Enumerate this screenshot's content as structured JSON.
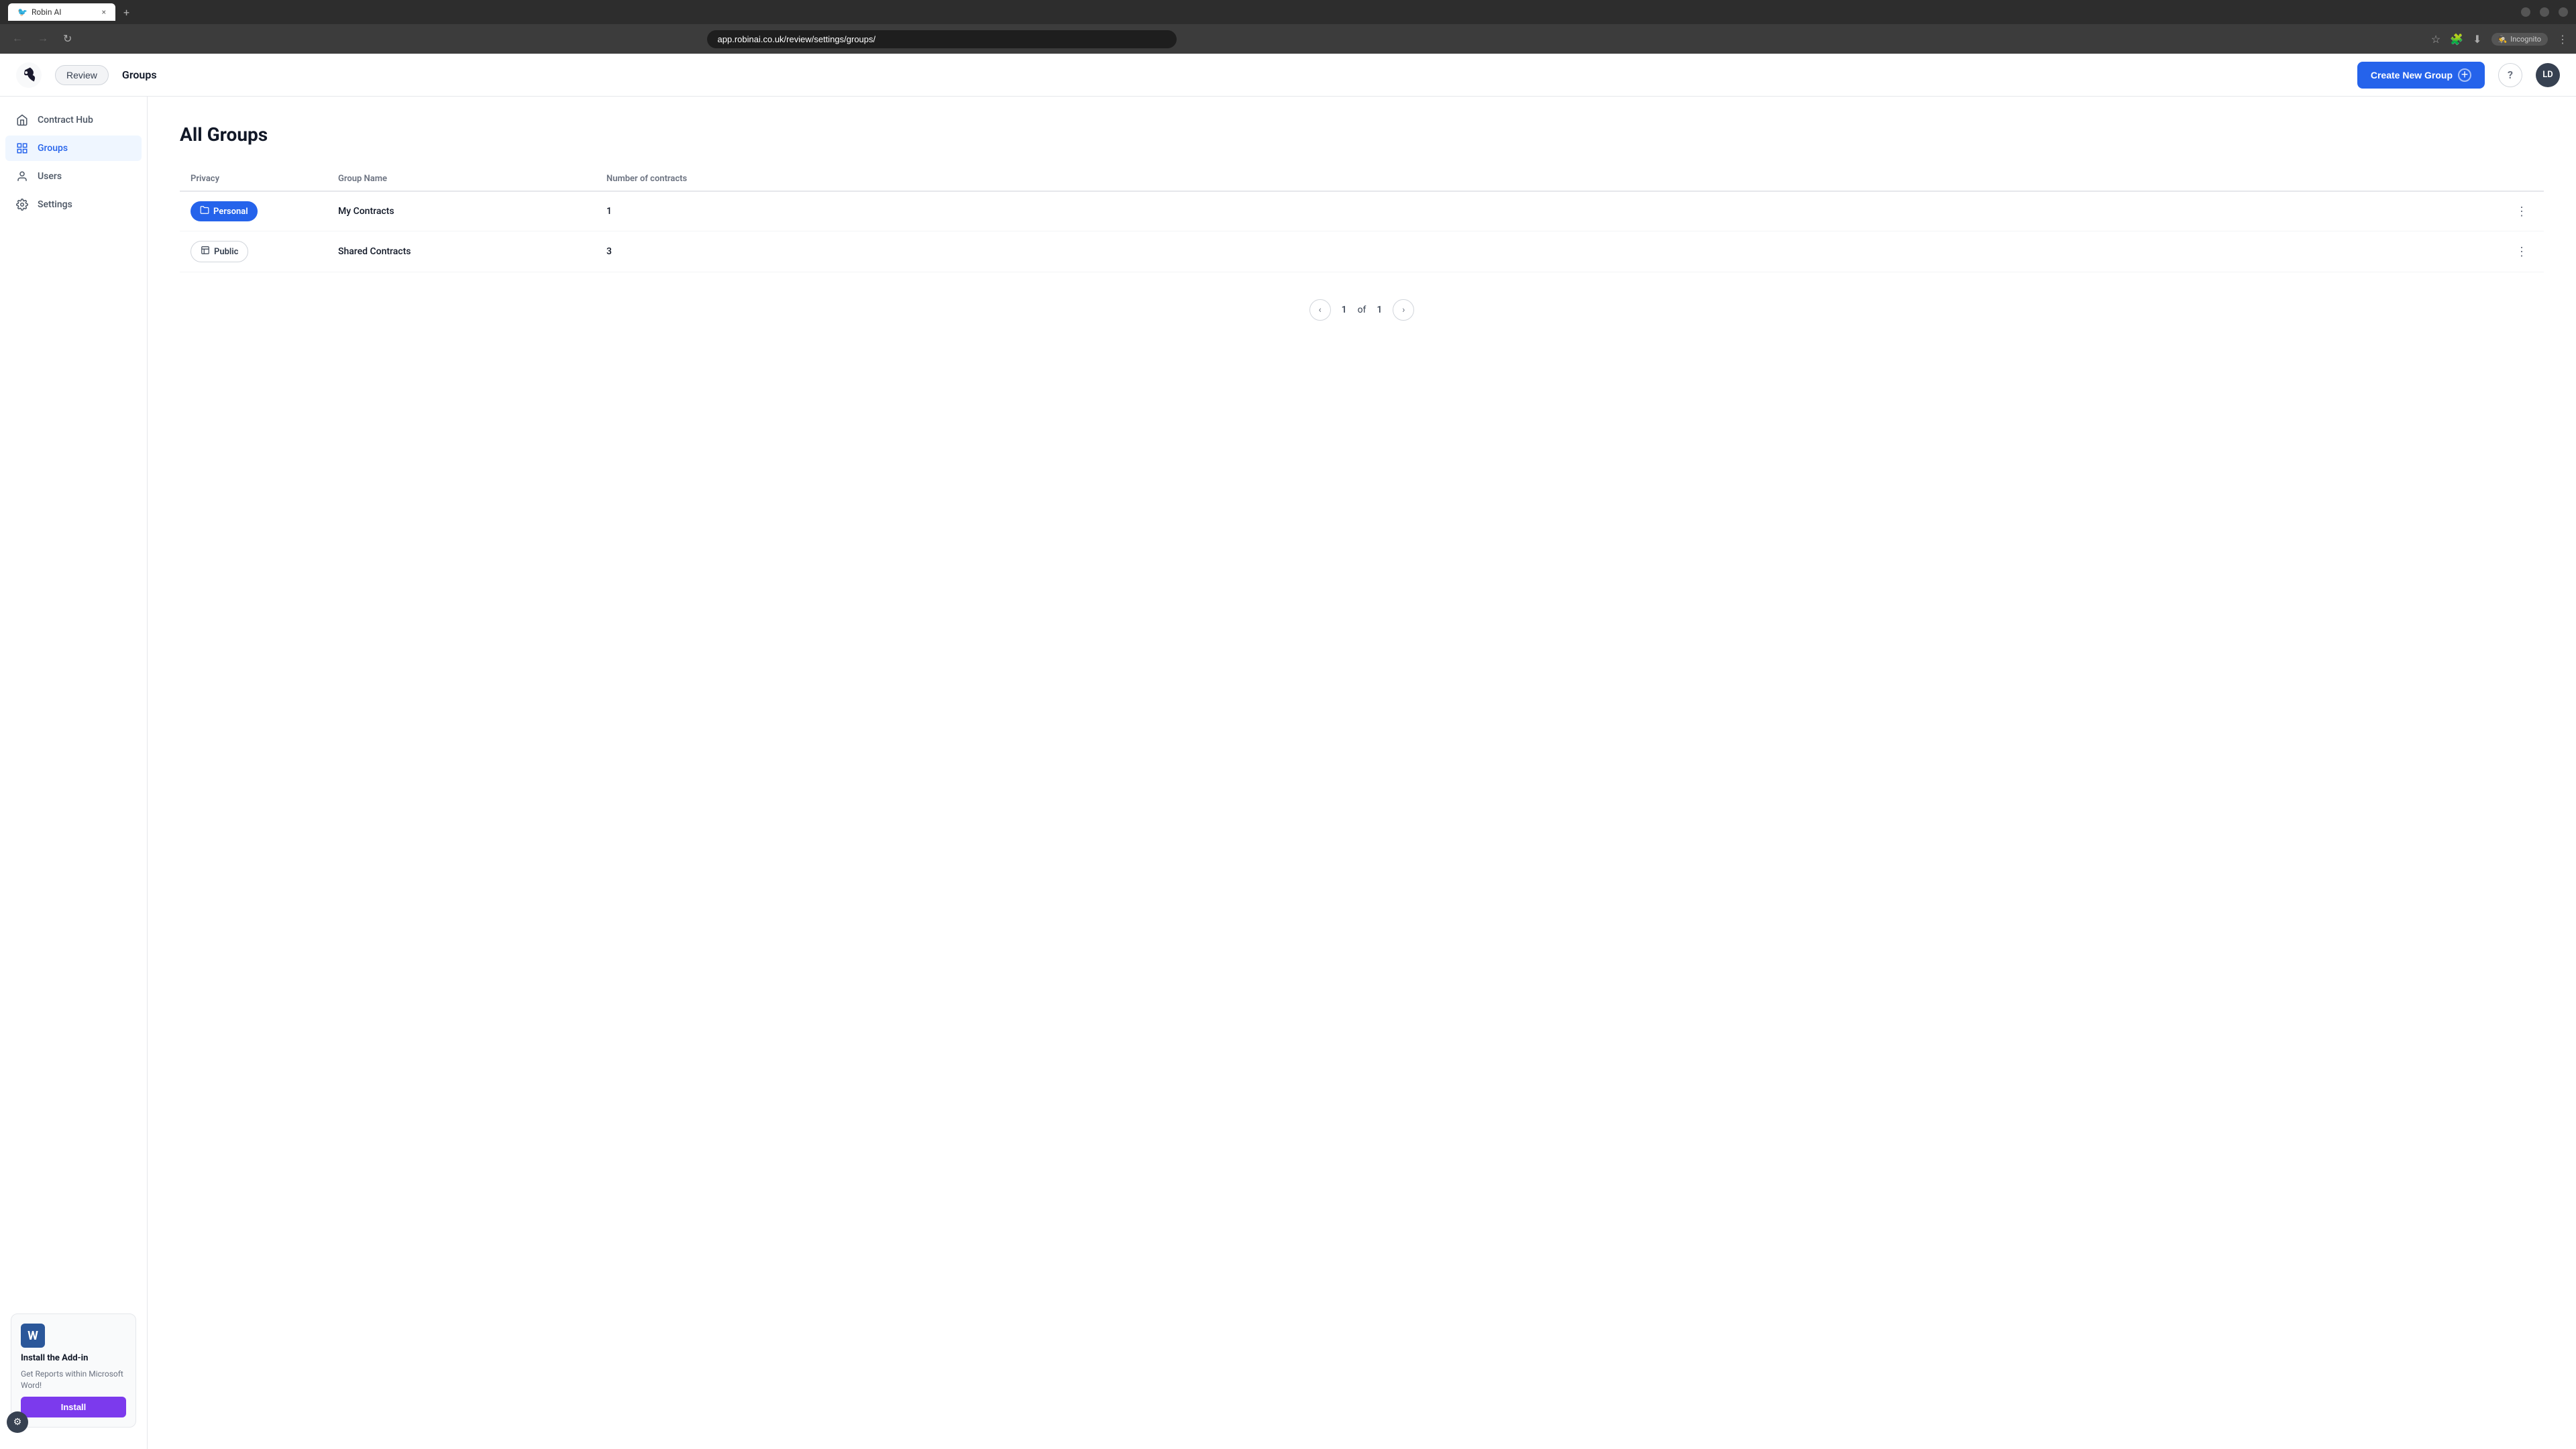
{
  "browser": {
    "tab_favicon": "🐦",
    "tab_title": "Robin AI",
    "tab_close": "×",
    "new_tab": "+",
    "url": "app.robinai.co.uk/review/settings/groups/",
    "incognito_label": "Incognito"
  },
  "header": {
    "review_label": "Review",
    "page_title": "Groups",
    "create_button_label": "Create New Group",
    "help_label": "?",
    "avatar_label": "LD"
  },
  "sidebar": {
    "items": [
      {
        "id": "contract-hub",
        "label": "Contract Hub",
        "icon": "🏠",
        "active": false
      },
      {
        "id": "groups",
        "label": "Groups",
        "icon": "⊞",
        "active": true
      },
      {
        "id": "users",
        "label": "Users",
        "icon": "👤",
        "active": false
      },
      {
        "id": "settings",
        "label": "Settings",
        "icon": "⚙",
        "active": false
      }
    ],
    "addon": {
      "word_icon": "W",
      "title": "Install the Add-in",
      "description": "Get Reports within Microsoft Word!",
      "install_button": "Install"
    }
  },
  "main": {
    "page_title": "All Groups",
    "table": {
      "headers": [
        "Privacy",
        "Group Name",
        "Number of contracts"
      ],
      "rows": [
        {
          "privacy_type": "personal",
          "privacy_label": "Personal",
          "group_name": "My Contracts",
          "contract_count": "1"
        },
        {
          "privacy_type": "public",
          "privacy_label": "Public",
          "group_name": "Shared Contracts",
          "contract_count": "3"
        }
      ]
    },
    "pagination": {
      "current_page": "1",
      "of_label": "of",
      "total_pages": "1"
    }
  },
  "icons": {
    "personal_folder": "📁",
    "public_folder": "🏛",
    "chevron_left": "‹",
    "chevron_right": "›",
    "plus": "+",
    "more_dots": "⋮",
    "gear": "⚙"
  }
}
